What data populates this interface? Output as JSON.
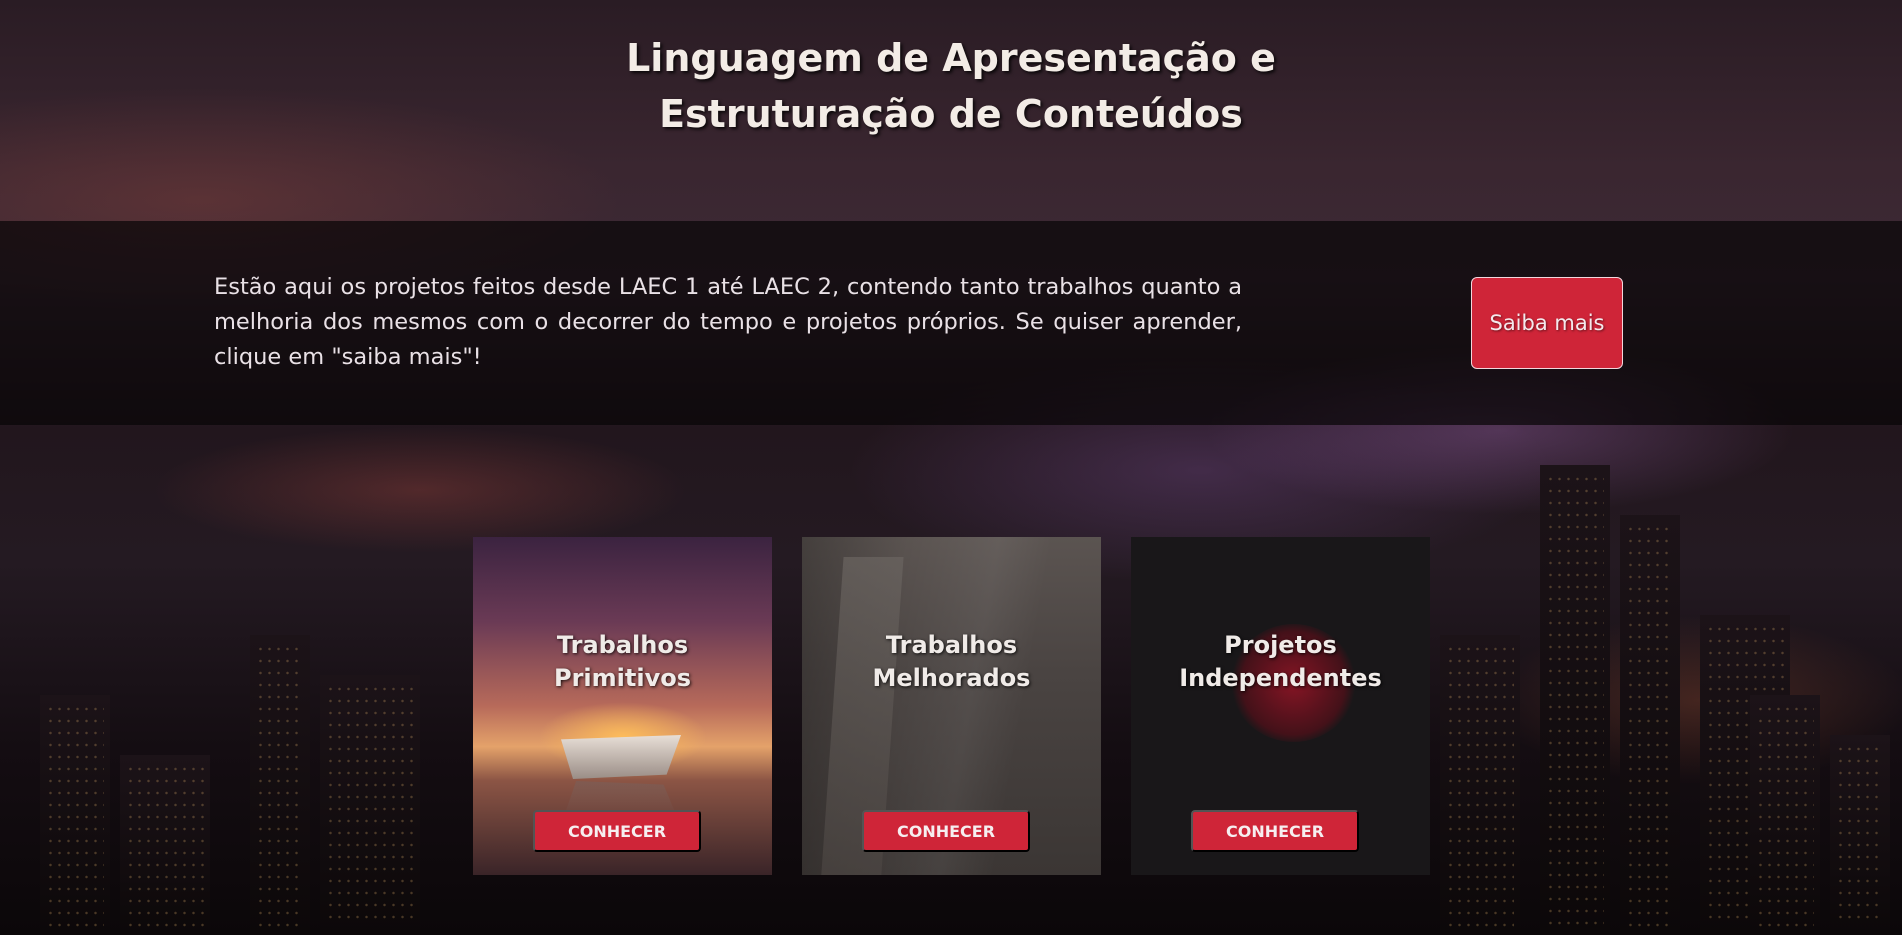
{
  "header": {
    "title_line1": "Linguagem de Apresentação e",
    "title_line2": "Estruturação de Conteúdos"
  },
  "intro": {
    "text": "Estão aqui os projetos feitos desde LAEC 1 até LAEC 2, contendo tanto trabalhos quanto a melhoria dos mesmos com o decorrer do tempo e projetos próprios. Se quiser aprender, clique em \"saiba mais\"!",
    "button_label": "Saiba mais"
  },
  "cards": [
    {
      "title_line1": "Trabalhos",
      "title_line2": "Primitivos",
      "button_label": "CONHECER"
    },
    {
      "title_line1": "Trabalhos",
      "title_line2": "Melhorados",
      "button_label": "CONHECER"
    },
    {
      "title_line1": "Projetos",
      "title_line2": "Independentes",
      "button_label": "CONHECER"
    }
  ],
  "colors": {
    "accent": "#cf2538",
    "intro_band": "#080507",
    "card_dark": "#191719"
  }
}
